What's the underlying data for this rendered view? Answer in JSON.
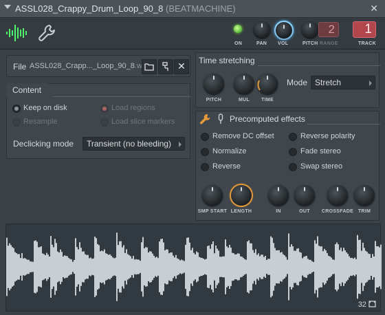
{
  "window": {
    "title": "ASSL028_Crappy_Drum_Loop_90_8",
    "plugin": "(BEATMACHINE)",
    "close_glyph": "✕",
    "menu_icon": "triangle-down-icon"
  },
  "toolbar": {
    "tabs": [
      {
        "name": "waveform-tab",
        "icon": "waveform-icon",
        "active": true
      },
      {
        "name": "settings-tab",
        "icon": "wrench-icon",
        "active": false
      }
    ],
    "on_label": "ON",
    "pan_label": "PAN",
    "vol_label": "VOL",
    "pitch_label": "PITCH",
    "range_label": "RANGE",
    "range_value": "2",
    "track_label": "TRACK",
    "track_value": "1",
    "accent_color": "#8fd6ff",
    "led_color": "#6cd14a"
  },
  "file": {
    "label": "File",
    "name": "ASSL028_Crapp..._Loop_90_8",
    "ext": ".wav",
    "icons": [
      "folder-open-icon",
      "fx-chain-icon",
      "close-icon"
    ]
  },
  "content": {
    "title": "Content",
    "options": [
      {
        "label": "Keep on disk",
        "checked": true,
        "enabled": true
      },
      {
        "label": "Load regions",
        "checked": true,
        "enabled": false
      },
      {
        "label": "Resample",
        "checked": false,
        "enabled": false
      },
      {
        "label": "Load slice markers",
        "checked": false,
        "enabled": false
      }
    ],
    "declicking_label": "Declicking mode",
    "declicking_value": "Transient (no bleeding)"
  },
  "time_stretching": {
    "title": "Time stretching",
    "knobs": [
      "PITCH",
      "MUL",
      "TIME"
    ],
    "mode_label": "Mode",
    "mode_value": "Stretch"
  },
  "precomputed": {
    "title": "Precomputed effects",
    "icons": [
      "wrench-icon",
      "microphone-icon"
    ],
    "effects_left": [
      "Remove DC offset",
      "Normalize",
      "Reverse"
    ],
    "effects_right": [
      "Reverse polarity",
      "Fade stereo",
      "Swap stereo"
    ],
    "knobs": [
      "SMP START",
      "LENGTH",
      "IN",
      "OUT",
      "CROSSFADE",
      "TRIM"
    ],
    "highlight_color": "#e59a3b"
  },
  "waveform": {
    "zoom_value": "32",
    "zoom_icon": "zoom-icon",
    "color": "#c8ced2"
  }
}
